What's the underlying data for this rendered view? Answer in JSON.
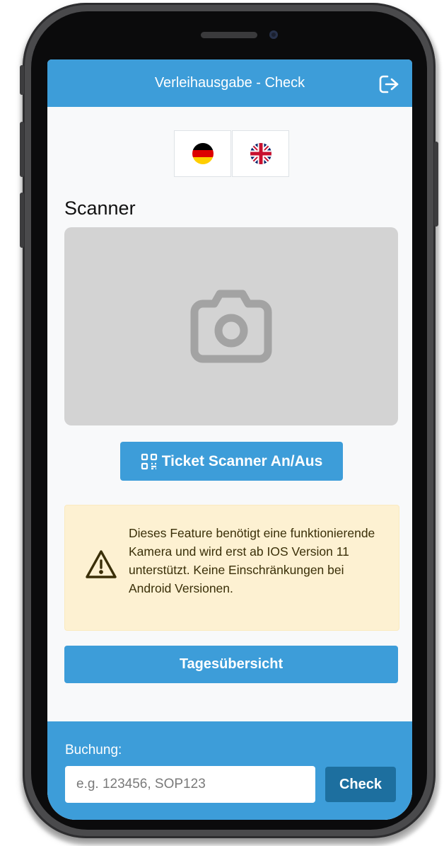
{
  "header": {
    "title": "Verleihausgabe - Check",
    "logout_icon": "logout-icon"
  },
  "languages": [
    {
      "code": "de",
      "icon": "germany-flag-icon"
    },
    {
      "code": "en",
      "icon": "uk-flag-icon"
    }
  ],
  "scanner": {
    "heading": "Scanner",
    "placeholder_icon": "camera-icon",
    "toggle_label": "Ticket Scanner An/Aus",
    "toggle_icon": "qr-code-icon"
  },
  "alert": {
    "icon": "warning-icon",
    "text": "Dieses Feature benötigt eine funktionierende Kamera und wird erst ab IOS Version 11 unterstützt. Keine Einschränkungen bei Android Versionen."
  },
  "overview_button": {
    "label": "Tagesübersicht"
  },
  "footer": {
    "label": "Buchung:",
    "input_placeholder": "e.g. 123456, SOP123",
    "input_value": "",
    "check_label": "Check"
  },
  "colors": {
    "primary": "#3d9dd9",
    "primary_dark": "#1d6f9f",
    "warning_bg": "#fdf1d2",
    "scanner_bg": "#d3d3d3"
  }
}
